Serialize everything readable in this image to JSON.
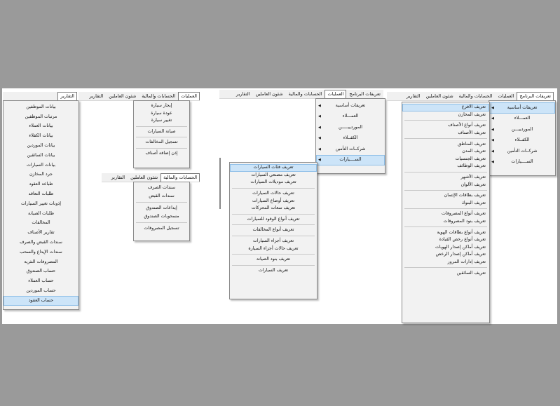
{
  "panel1": {
    "menubar": [
      {
        "id": "reports",
        "label": "التقارير",
        "open": true
      }
    ],
    "menu": [
      "بيانات الموظفين",
      "مرتبات الموظفين",
      "بيانات العملاء",
      "بيانات الكفلاء",
      "بيانات الموردين",
      "بيانات السائقين",
      "بيانات السيارات",
      "جرد المخازن",
      "طباعة العقود",
      "طلبات التعاقد",
      "إذونات تغيير السيارات",
      "طلبات الصيانة",
      "المخالفات",
      "تقارير الأصناف",
      "سندات القبض والصرف",
      "سندات الإيداع والسحب",
      "المصروفات النثرية",
      "حساب الصندوق",
      "حساب العملاء",
      "حساب الموردين",
      "حساب العقود"
    ],
    "highlighted": 20
  },
  "panel2": {
    "menubar": [
      {
        "label": "العمليات",
        "open": true
      },
      {
        "label": "الحسابات والمالية"
      },
      {
        "label": "شئون العاملين"
      },
      {
        "label": "التقارير"
      }
    ],
    "menu": [
      {
        "label": "إيجار سيارة"
      },
      {
        "label": "عودة سيارة"
      },
      {
        "label": "تغيير سيارة"
      },
      {
        "sep": true
      },
      {
        "label": "صيانة السيارات"
      },
      {
        "sep": true
      },
      {
        "label": "تسجيل المخالفات"
      },
      {
        "sep": true
      },
      {
        "label": "إذن إضافة أصناف"
      }
    ]
  },
  "panel3": {
    "menubar": [
      {
        "label": "الحسابات والمالية",
        "open": true
      },
      {
        "label": "شئون العاملين"
      },
      {
        "label": "التقارير"
      }
    ],
    "menu": [
      {
        "label": "سندات الصرف"
      },
      {
        "label": "سندات القبض"
      },
      {
        "sep": true
      },
      {
        "label": "إيداعات الصندوق"
      },
      {
        "label": "مسحوبات الصندوق"
      },
      {
        "sep": true
      },
      {
        "label": "تسجيل المصروفات"
      }
    ]
  },
  "panel4": {
    "menubar": [
      {
        "label": "تعريفات البرنامج"
      },
      {
        "label": "العمليات",
        "open": true
      },
      {
        "label": "الحسابات والمالية"
      },
      {
        "label": "شئون العاملين"
      },
      {
        "label": "التقارير"
      }
    ],
    "menu": [
      {
        "label": "تعريفات أساسية"
      },
      {
        "label": "العمـــلاء"
      },
      {
        "label": "الموردييـــــن"
      },
      {
        "label": "الكفــلاء"
      },
      {
        "label": "شركــات التأمين"
      },
      {
        "label": "الســــيارات",
        "highlighted": true
      }
    ],
    "submenu": [
      {
        "label": "تعريف فئات السيارات",
        "highlighted": true
      },
      {
        "label": "تعريف مصنعي السيارات"
      },
      {
        "label": "تعريف موديلات السيارات"
      },
      {
        "sep": true
      },
      {
        "label": "تعريف حالات السيارات"
      },
      {
        "label": "تعريف أوضاع السيارات"
      },
      {
        "label": "تعريف سعات المحركات"
      },
      {
        "sep": true
      },
      {
        "label": "تعريف أنواع الوقود للسيارات"
      },
      {
        "sep": true
      },
      {
        "label": "تعريف أنواع المخالفات"
      },
      {
        "sep": true
      },
      {
        "label": "تعريف أجزاء السيارات"
      },
      {
        "label": "تعريف حالات أجزاء السيارة"
      },
      {
        "sep": true
      },
      {
        "label": "تعريف بنود الصيانة"
      },
      {
        "sep": true
      },
      {
        "label": "تعريف السيارات"
      }
    ]
  },
  "panel5": {
    "menubar": [
      {
        "label": "تعريفات البرنامج",
        "open": true
      },
      {
        "label": "العمليات"
      },
      {
        "label": "الحسابات والمالية"
      },
      {
        "label": "شئون العاملين"
      },
      {
        "label": "التقارير"
      }
    ],
    "menu": [
      {
        "label": "تعريفات أساسية",
        "highlighted": true
      },
      {
        "label": "العمـــلاء"
      },
      {
        "label": "الموردييـــن"
      },
      {
        "label": "الكفــلاء"
      },
      {
        "label": "شركــات التأمين"
      },
      {
        "label": "الســــيارات"
      }
    ],
    "submenu": [
      {
        "label": "تعريف الأفرع",
        "highlighted": true
      },
      {
        "label": "تعريف المخازن"
      },
      {
        "sep": true
      },
      {
        "label": "تعريف أنواع الأصناف"
      },
      {
        "label": "تعريف الأصناف"
      },
      {
        "sep": true
      },
      {
        "label": "تعريف المناطق"
      },
      {
        "label": "تعريف المدن"
      },
      {
        "label": "تعريف الجنسيات"
      },
      {
        "label": "تعريف الوظائف"
      },
      {
        "sep": true
      },
      {
        "label": "تعريف الأشهر"
      },
      {
        "label": "تعريف الألوان"
      },
      {
        "sep": true
      },
      {
        "label": "تعريف بطاقات الإئتمان"
      },
      {
        "label": "تعريف البنوك"
      },
      {
        "sep": true
      },
      {
        "label": "تعريف أنواع المصروفات"
      },
      {
        "label": "تعريف بنود المصروفات"
      },
      {
        "sep": true
      },
      {
        "label": "تعريف أنواع بطاقات الهوية"
      },
      {
        "label": "تعريف أنواع رخص القيادة"
      },
      {
        "label": "تعريف أماكن إصدار الهويات"
      },
      {
        "label": "تعريف أماكن إصدار الرخص"
      },
      {
        "label": "تعريف إدارات المرور"
      },
      {
        "sep": true
      },
      {
        "label": "تعريف السائقين"
      }
    ]
  },
  "colors": {
    "background": "#9a9a9a",
    "canvas": "#ffffff",
    "menu_bg": "#f2f2f2",
    "highlight": "#cce4f8"
  }
}
